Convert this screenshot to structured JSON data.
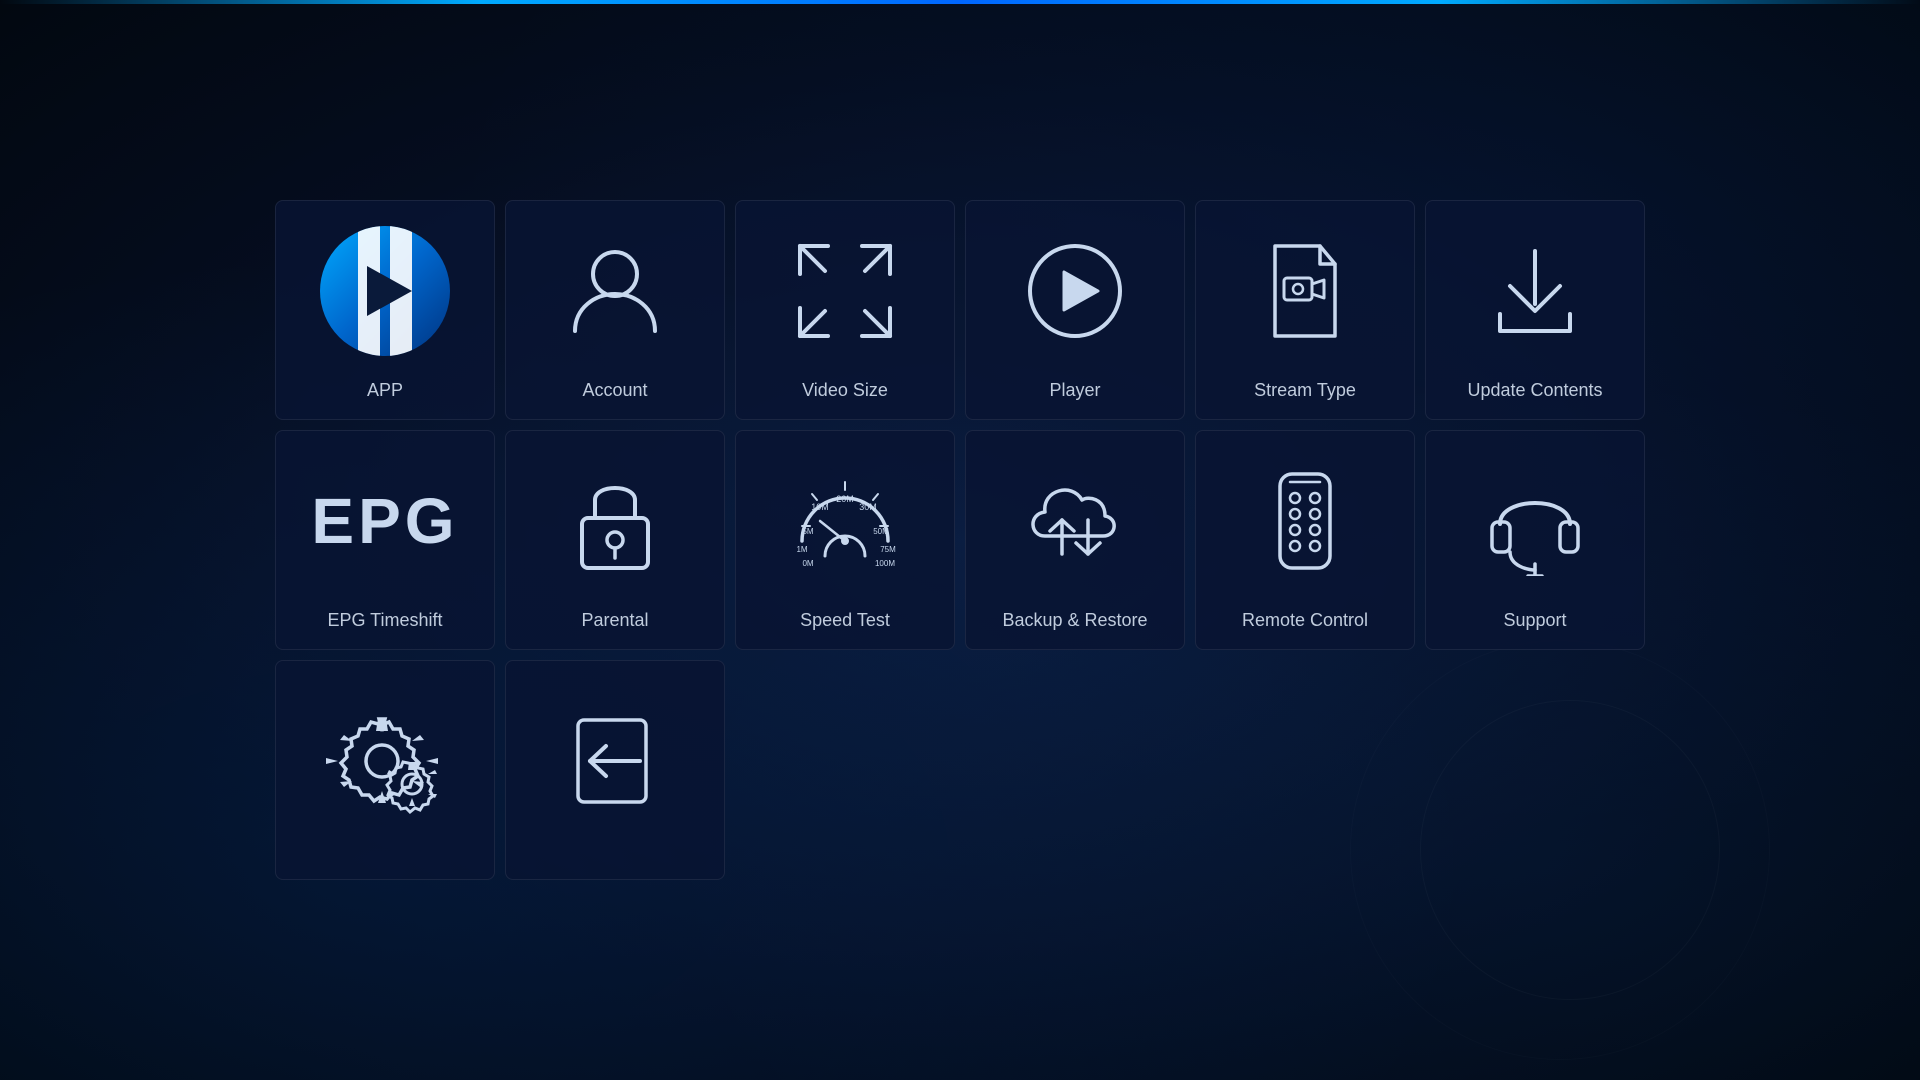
{
  "grid": {
    "items": [
      {
        "id": "app",
        "label": "APP"
      },
      {
        "id": "account",
        "label": "Account"
      },
      {
        "id": "video-size",
        "label": "Video Size"
      },
      {
        "id": "player",
        "label": "Player"
      },
      {
        "id": "stream-type",
        "label": "Stream Type"
      },
      {
        "id": "update-contents",
        "label": "Update Contents"
      },
      {
        "id": "epg-timeshift",
        "label": "EPG Timeshift"
      },
      {
        "id": "parental",
        "label": "Parental"
      },
      {
        "id": "speed-test",
        "label": "Speed Test"
      },
      {
        "id": "backup-restore",
        "label": "Backup & Restore"
      },
      {
        "id": "remote-control",
        "label": "Remote Control"
      },
      {
        "id": "support",
        "label": "Support"
      },
      {
        "id": "settings",
        "label": ""
      },
      {
        "id": "logout",
        "label": ""
      }
    ]
  }
}
